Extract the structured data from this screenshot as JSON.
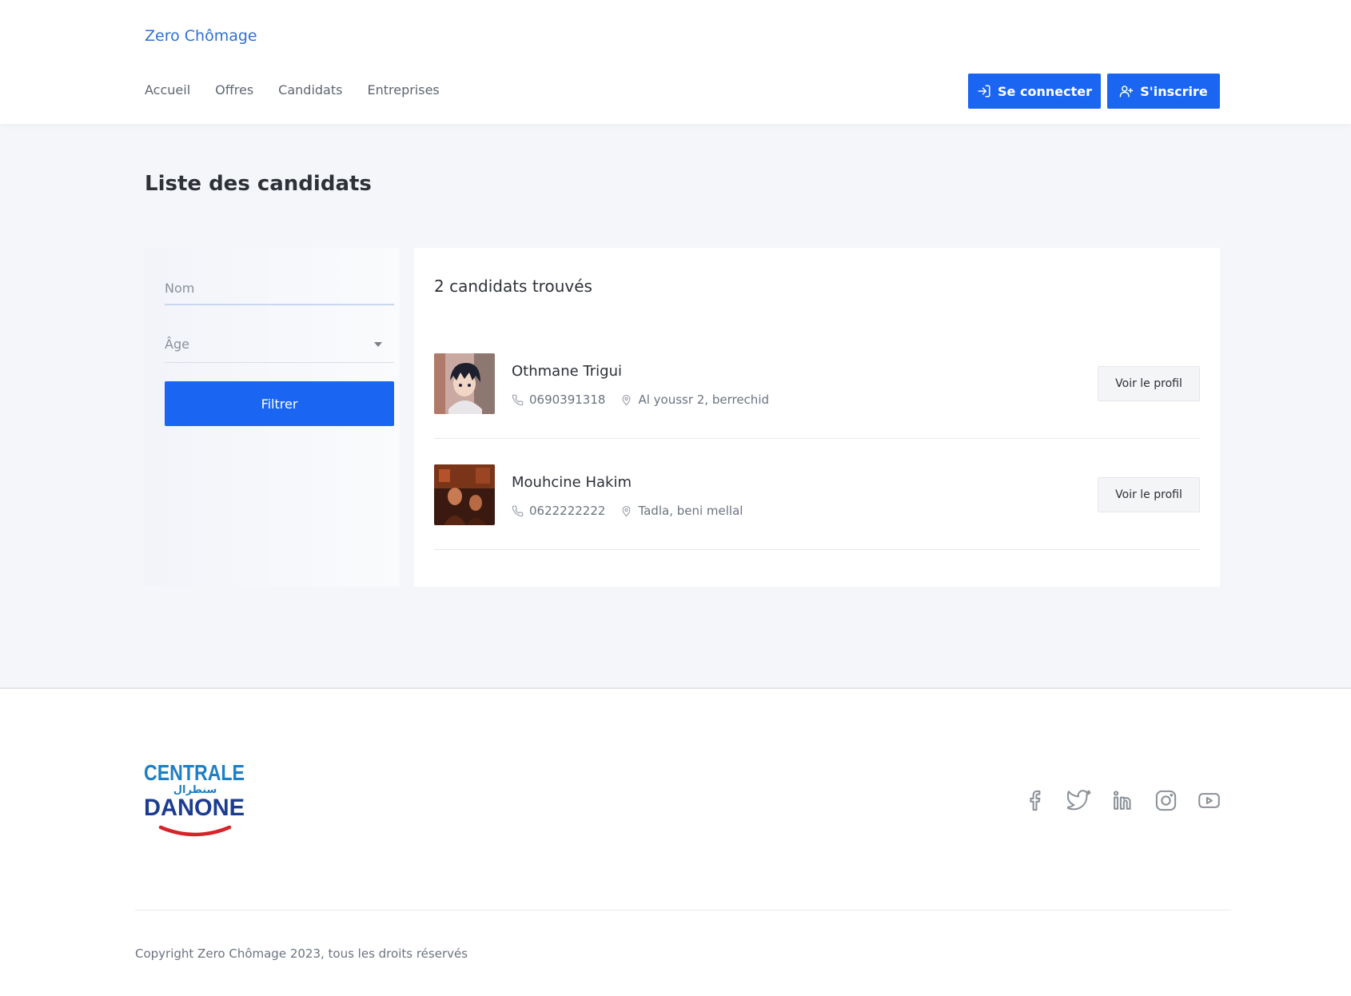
{
  "header": {
    "brand": "Zero Chômage",
    "nav": [
      "Accueil",
      "Offres",
      "Candidats",
      "Entreprises"
    ],
    "login_label": "Se connecter",
    "signup_label": "S'inscrire"
  },
  "main": {
    "title": "Liste des candidats",
    "filter": {
      "name_placeholder": "Nom",
      "name_value": "",
      "age_placeholder": "Âge",
      "button_label": "Filtrer"
    },
    "results_count": "2 candidats trouvés",
    "candidates": [
      {
        "name": "Othmane Trigui",
        "phone": "0690391318",
        "address": "Al youssr 2, berrechid",
        "action_label": "Voir le profil"
      },
      {
        "name": "Mouhcine Hakim",
        "phone": "0622222222",
        "address": "Tadla, beni mellal",
        "action_label": "Voir le profil"
      }
    ]
  },
  "footer": {
    "logo_text": {
      "line1": "CENTRALE",
      "arabic": "سنطرال",
      "line2": "DANONE"
    },
    "social_icons": [
      "facebook-icon",
      "twitter-icon",
      "linkedin-icon",
      "instagram-icon",
      "youtube-icon"
    ],
    "copyright": "Copyright Zero Chômage 2023, tous les droits réservés"
  },
  "colors": {
    "primary": "#1a66f2",
    "brand_link": "#2f6fd6",
    "page_bg": "#f5f6fa",
    "logo_blue": "#1d7fc4",
    "logo_navy": "#1c3d8f",
    "logo_red": "#d8232a"
  }
}
